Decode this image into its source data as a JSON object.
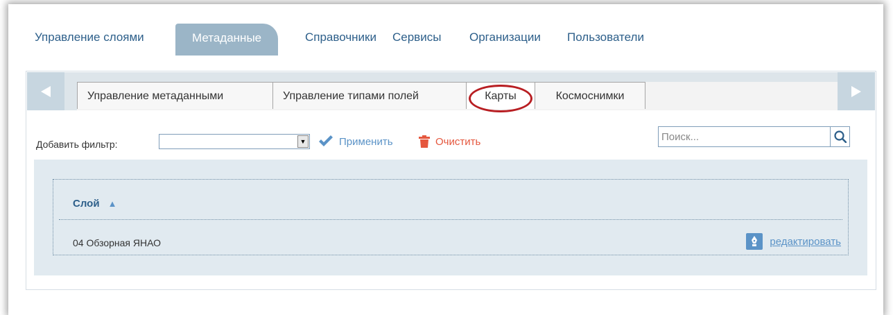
{
  "main_nav": {
    "items": [
      {
        "label": "Управление слоями",
        "active": false
      },
      {
        "label": "Метаданные",
        "active": true
      },
      {
        "label": "Справочники",
        "active": false
      },
      {
        "label": "Сервисы",
        "active": false
      },
      {
        "label": "Организации",
        "active": false
      },
      {
        "label": "Пользователи",
        "active": false
      }
    ]
  },
  "subtabs": {
    "items": [
      {
        "label": "Управление метаданными"
      },
      {
        "label": "Управление типами полей"
      },
      {
        "label": "Карты",
        "active": true,
        "highlighted": true
      },
      {
        "label": "Космоснимки"
      }
    ],
    "prev_icon": "triangle-left-icon",
    "next_icon": "triangle-right-icon"
  },
  "filter": {
    "label": "Добавить фильтр:",
    "select_value": "",
    "apply_label": "Применить",
    "clear_label": "Очистить"
  },
  "search": {
    "placeholder": "Поиск...",
    "icon": "search-icon"
  },
  "grid": {
    "column_header": "Слой",
    "sort": "ascending",
    "rows": [
      {
        "name": "04 Обзорная ЯНАО",
        "action_label": "редактировать"
      }
    ]
  },
  "colors": {
    "link": "#2d5f8a",
    "accent": "#5b93c7",
    "danger": "#e5573e",
    "active_tab_bg": "#9bb5c7",
    "highlight_ring": "#b81e22"
  }
}
